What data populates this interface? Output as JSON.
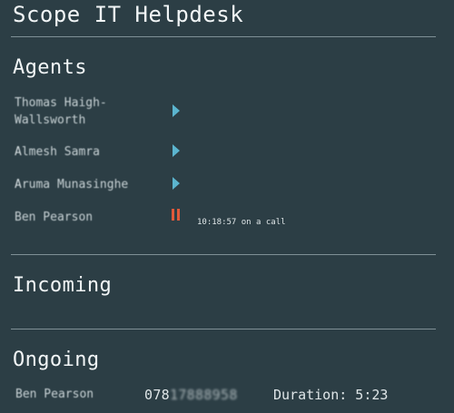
{
  "app": {
    "title": "Scope IT Helpdesk"
  },
  "sections": {
    "agents_title": "Agents",
    "incoming_title": "Incoming",
    "ongoing_title": "Ongoing"
  },
  "agents": [
    {
      "name_line1": "Thomas Haigh-",
      "name_line2": "Wallsworth",
      "status_icon": "play-icon"
    },
    {
      "lead": "A",
      "name_rest": "lmesh Samra",
      "status_icon": "play-icon"
    },
    {
      "lead": "A",
      "name_rest": "ruma Munasinghe",
      "status_icon": "play-icon"
    },
    {
      "name": "Ben Pearson",
      "status_icon": "pause-icon",
      "call_status": "10:18:57 on a call"
    }
  ],
  "ongoing": [
    {
      "agent": "Ben Pearson",
      "phone_prefix": "078",
      "phone_masked": "17888958",
      "duration": "Duration: 5:23"
    }
  ],
  "colors": {
    "background": "#2c3e45",
    "play": "#5bb5cf",
    "pause": "#e05a3a",
    "divider": "#7f9096"
  }
}
